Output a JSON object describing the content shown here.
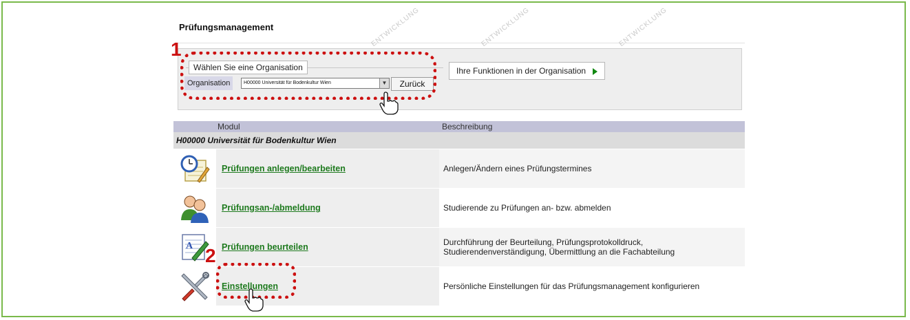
{
  "app": {
    "title": "Prüfungsmanagement",
    "org_legend": "Wählen Sie eine Organisation",
    "org_label": "Organisation",
    "org_selected": "H00000 Universität für Bodenkultur Wien",
    "back_button": "Zurück",
    "functions_button": "Ihre Funktionen in der Organisation"
  },
  "table": {
    "headers": {
      "module": "Modul",
      "description": "Beschreibung"
    },
    "org_row": "H00000 Universität für Bodenkultur Wien",
    "rows": [
      {
        "icon": "calendar-clock-icon",
        "label": "Prüfungen anlegen/bearbeiten",
        "description": "Anlegen/Ändern eines Prüfungstermines"
      },
      {
        "icon": "users-icon",
        "label": "Prüfungsan-/abmeldung",
        "description": "Studierende zu Prüfungen an- bzw. abmelden"
      },
      {
        "icon": "grading-pen-icon",
        "label": "Prüfungen beurteilen",
        "description": "Durchführung der Beurteilung, Prüfungsprotokolldruck, Studierendenverständigung, Übermittlung an die Fachabteilung"
      },
      {
        "icon": "tools-icon",
        "label": "Einstellungen",
        "description": "Persönliche Einstellungen für das Prüfungsmanagement konfigurieren"
      }
    ]
  },
  "annotations": {
    "step1": "1",
    "step2": "2"
  },
  "colors": {
    "frame": "#79b94a",
    "link": "#1e7a1e",
    "annotation": "#cc1111",
    "header": "#c2c2d8"
  }
}
